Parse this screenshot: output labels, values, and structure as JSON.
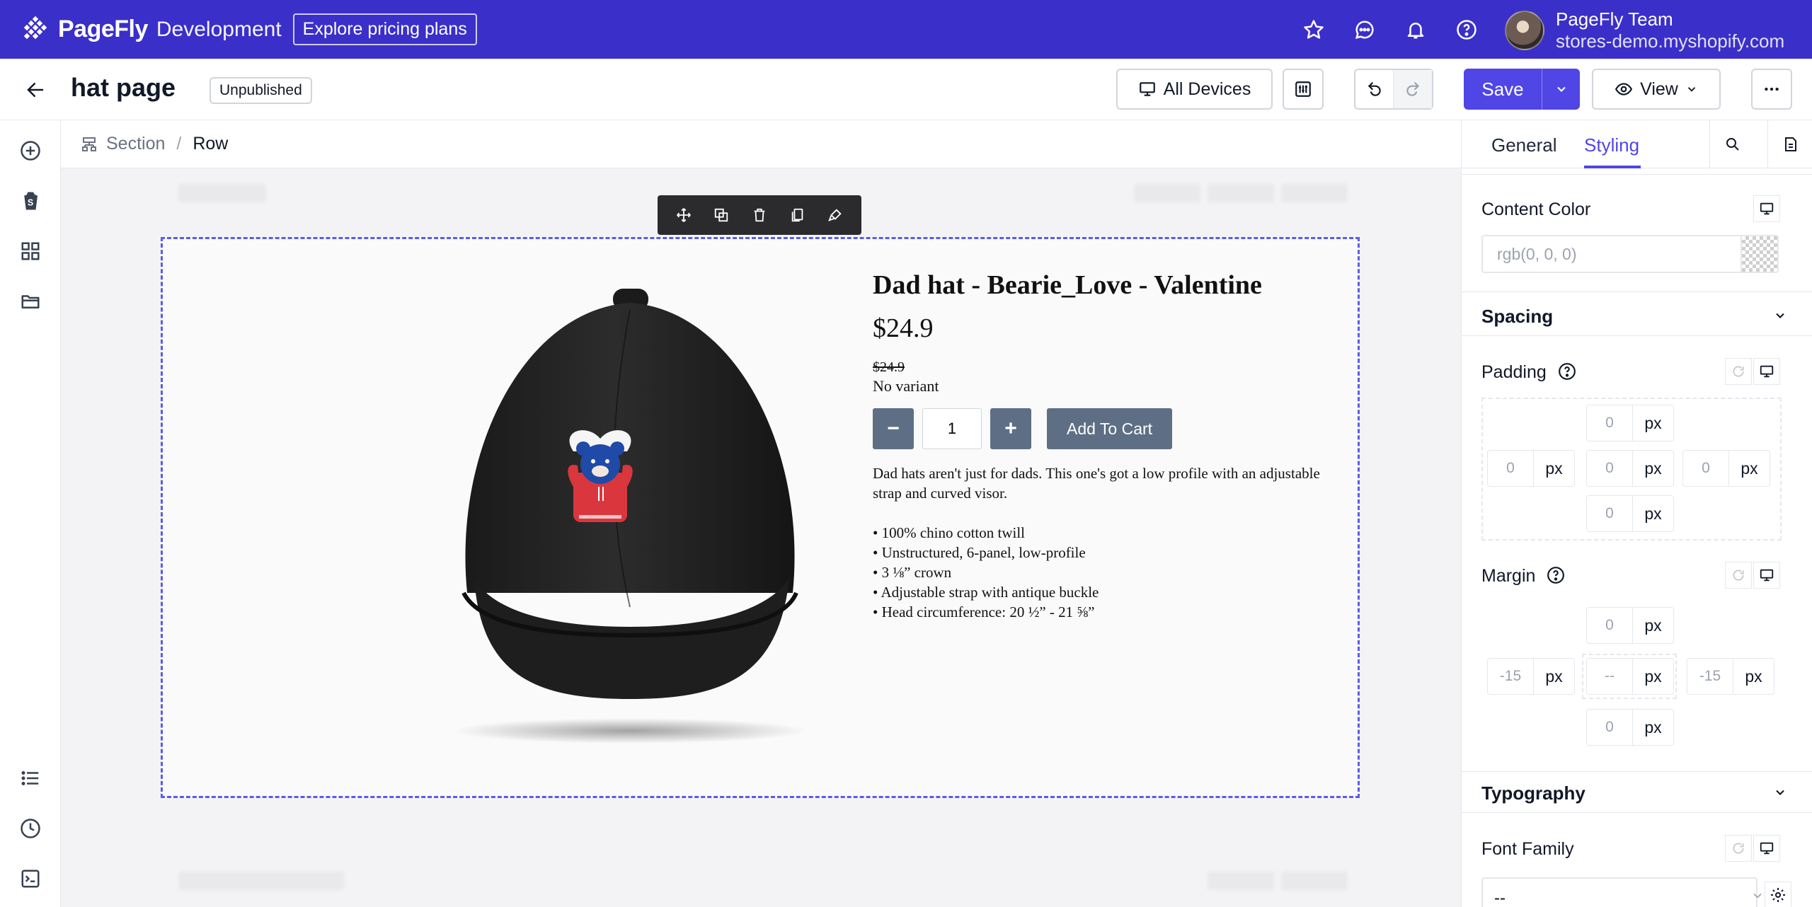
{
  "topbar": {
    "brand_name": "PageFly",
    "brand_env": "Development",
    "pricing_label": "Explore pricing plans",
    "icons": [
      "star-icon",
      "chat-icon",
      "bell-icon",
      "help-icon"
    ],
    "user_name": "PageFly Team",
    "user_store": "stores-demo.myshopify.com",
    "background_color": "#3b2fc9"
  },
  "editorbar": {
    "page_title": "hat page",
    "status": "Unpublished",
    "devices_label": "All Devices",
    "save_label": "Save",
    "view_label": "View",
    "accent_color": "#4f46e5"
  },
  "breadcrumb": {
    "items": [
      "Section",
      "Row"
    ]
  },
  "product": {
    "title": "Dad hat - Bearie_Love - Valentine",
    "price": "$24.9",
    "compare_price": "$24.9",
    "variant": "No variant",
    "quantity": "1",
    "minus": "−",
    "plus": "+",
    "add_to_cart": "Add To Cart",
    "description": "Dad hats aren't just for dads. This one's got a low profile with an adjustable strap and curved visor.",
    "bullets": [
      "• 100% chino cotton twill",
      "• Unstructured, 6-panel, low-profile",
      "• 3 ⅛” crown",
      "• Adjustable strap with antique buckle",
      "• Head circumference: 20 ½” - 21 ⅝”"
    ]
  },
  "panel": {
    "tabs": [
      "General",
      "Styling"
    ],
    "active_tab": "Styling",
    "content_color_label": "Content Color",
    "content_color_placeholder": "rgb(0, 0, 0)",
    "spacing_title": "Spacing",
    "padding_label": "Padding",
    "padding": {
      "top": "0",
      "right": "0",
      "bottom": "0",
      "left": "0",
      "center": "0",
      "unit": "px"
    },
    "margin_label": "Margin",
    "margin": {
      "top": "0",
      "right": "-15",
      "bottom": "0",
      "left": "-15",
      "center": "--",
      "unit": "px"
    },
    "typography_title": "Typography",
    "font_family_label": "Font Family",
    "font_family_value": "--"
  }
}
